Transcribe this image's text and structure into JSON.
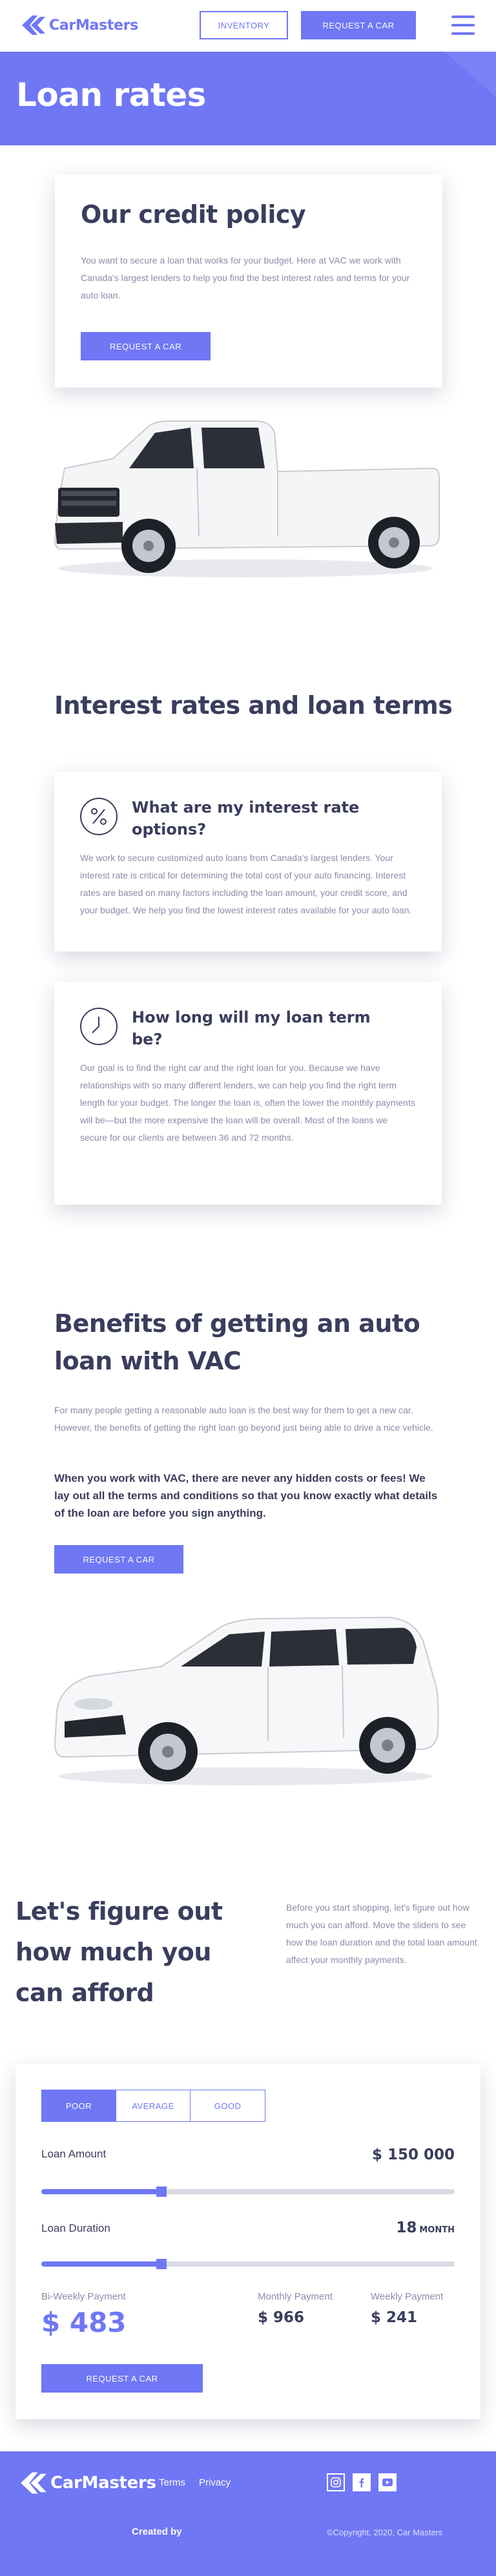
{
  "header": {
    "brand": "CarMasters",
    "inventory_label": "INVENTORY",
    "request_label": "REQUEST A CAR"
  },
  "hero": {
    "title": "Loan rates"
  },
  "policy": {
    "title": "Our credit policy",
    "text": "You want to secure a loan that works for your budget. Here at VAC we work with Canada's largest lenders to help you find the best interest rates and terms for your auto loan.",
    "button": "REQUEST A CAR"
  },
  "interest": {
    "title": "Interest rates and loan terms",
    "cards": [
      {
        "icon": "percent-icon",
        "title": "What are my interest rate options?",
        "text": "We work to secure customized auto loans from Canada's largest lenders. Your interest rate is critical for determining the total cost of your auto financing. Interest rates are based on many factors including the loan amount, your credit score, and your budget. We help you find the lowest interest rates available for your auto loan."
      },
      {
        "icon": "clock-icon",
        "title": "How long will my loan term be?",
        "text": "Our goal is to find the right car and the right loan for you. Because we have relationships with so many different lenders, we can help you find the right term length for your budget. The longer the loan is, often the lower the monthly payments will be—but the more expensive the loan will be overall. Most of the loans we secure for our clients are between 36 and 72 months."
      }
    ]
  },
  "benefits": {
    "title": "Benefits of getting an auto loan with VAC",
    "text": "For many people getting a reasonable auto loan is the best way for them to get a new car. However, the benefits of getting the right loan go beyond just being able to drive a nice vehicle.",
    "bold": "When you work with VAC, there are never any hidden costs or fees! We lay out all the terms and conditions so that you know exactly what details of the loan are before you sign anything.",
    "button": "REQUEST A CAR"
  },
  "afford": {
    "title": "Let's figure out how much you can afford",
    "text": "Before you start shopping, let's figure out how much you can afford. Move the sliders to see how the loan duration and the total loan amount affect your monthly payments."
  },
  "calculator": {
    "tabs": [
      "POOR",
      "AVERAGE",
      "GOOD"
    ],
    "active_tab": 0,
    "loan_amount_label": "Loan Amount",
    "loan_amount_value": "$ 150 000",
    "loan_amount_fraction": 0.29,
    "loan_duration_label": "Loan Duration",
    "loan_duration_value": "18",
    "loan_duration_unit": "MONTH",
    "loan_duration_fraction": 0.29,
    "biweekly_label": "Bi-Weekly Payment",
    "biweekly_value": "$ 483",
    "monthly_label": "Monthly Payment",
    "monthly_value": "$ 966",
    "weekly_label": "Weekly Payment",
    "weekly_value": "$ 241",
    "button": "REQUEST A CAR"
  },
  "footer": {
    "brand": "CarMasters",
    "terms": "Terms",
    "privacy": "Privacy",
    "created_by": "Created by",
    "copyright": "©Copyright, 2020, Car Masters",
    "social": [
      "instagram-icon",
      "facebook-icon",
      "youtube-icon"
    ]
  },
  "colors": {
    "accent": "#6f77f5",
    "heading": "#3a3d5c",
    "body_text": "#8a8da8"
  }
}
